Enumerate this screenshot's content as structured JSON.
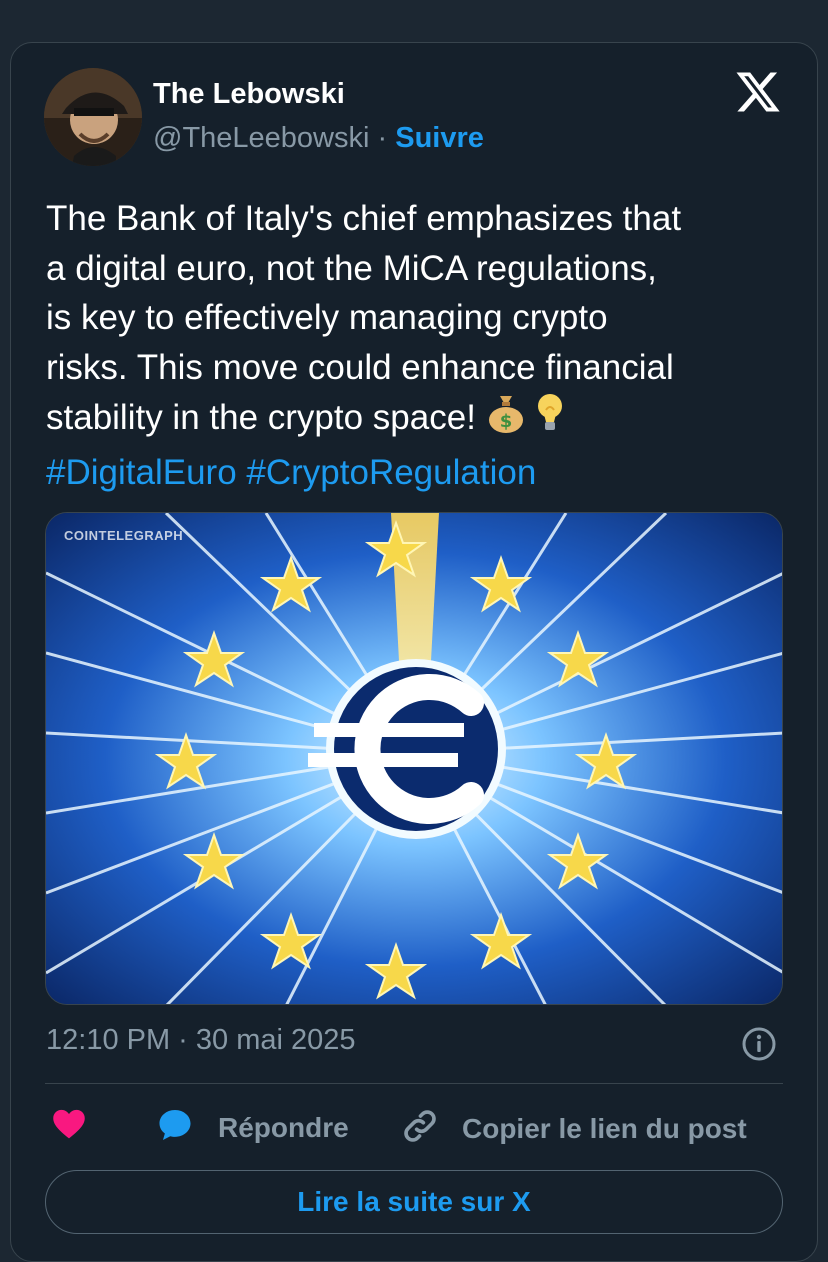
{
  "tweet": {
    "author_name": "The Lebowski",
    "handle": "@TheLeebowski",
    "separator": "·",
    "follow_label": "Suivre",
    "text_lines": [
      "The Bank of Italy's chief emphasizes that",
      "a digital euro, not the MiCA regulations,",
      "is key to effectively managing crypto",
      "risks. This move could enhance financial",
      "stability in the crypto space!"
    ],
    "emojis": [
      "money-bag",
      "light-bulb"
    ],
    "hashtags": [
      "#DigitalEuro",
      "#CryptoRegulation"
    ],
    "media_watermark": "COINTELEGRAPH",
    "timestamp": "12:10 PM · 30 mai 2025"
  },
  "actions": {
    "like_icon": "heart-icon",
    "reply_label": "Répondre",
    "copy_link_label": "Copier le lien du post"
  },
  "read_more_label": "Lire la suite sur X",
  "colors": {
    "background": "#15202b",
    "accent": "#1d9bf0",
    "like": "#f91880",
    "muted_text": "#8899a6"
  }
}
